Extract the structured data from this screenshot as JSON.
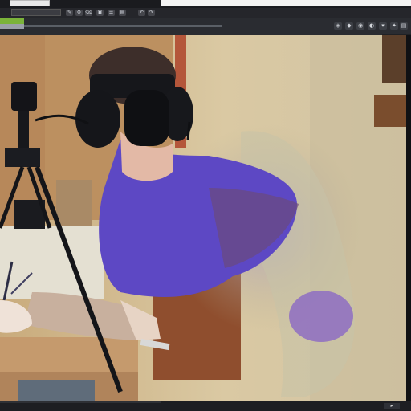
{
  "window": {
    "tab_text": "",
    "layer_name": ""
  },
  "toolbar": {
    "icons": [
      "brush-icon",
      "settings-icon",
      "eraser-icon",
      "folder-icon",
      "layers-icon",
      "image-icon",
      "undo-icon",
      "redo-icon",
      "play-icon",
      "more-icon"
    ],
    "glyphs": [
      "✎",
      "⚙",
      "⌫",
      "▣",
      "☰",
      "▤",
      "↶",
      "↷",
      "▸",
      "⋯"
    ]
  },
  "docbar": {
    "glyphs": [
      "◈",
      "◆",
      "◉",
      "◐",
      "▾",
      "✦",
      "▤"
    ]
  },
  "canvas": {
    "description_colors": {
      "wall": "#d7c49c",
      "door": "#b58d5a",
      "shirt": "#6e55c8",
      "desk": "#c39a6c"
    }
  },
  "footer": {
    "nav_label": "▸"
  },
  "side_tag": ""
}
